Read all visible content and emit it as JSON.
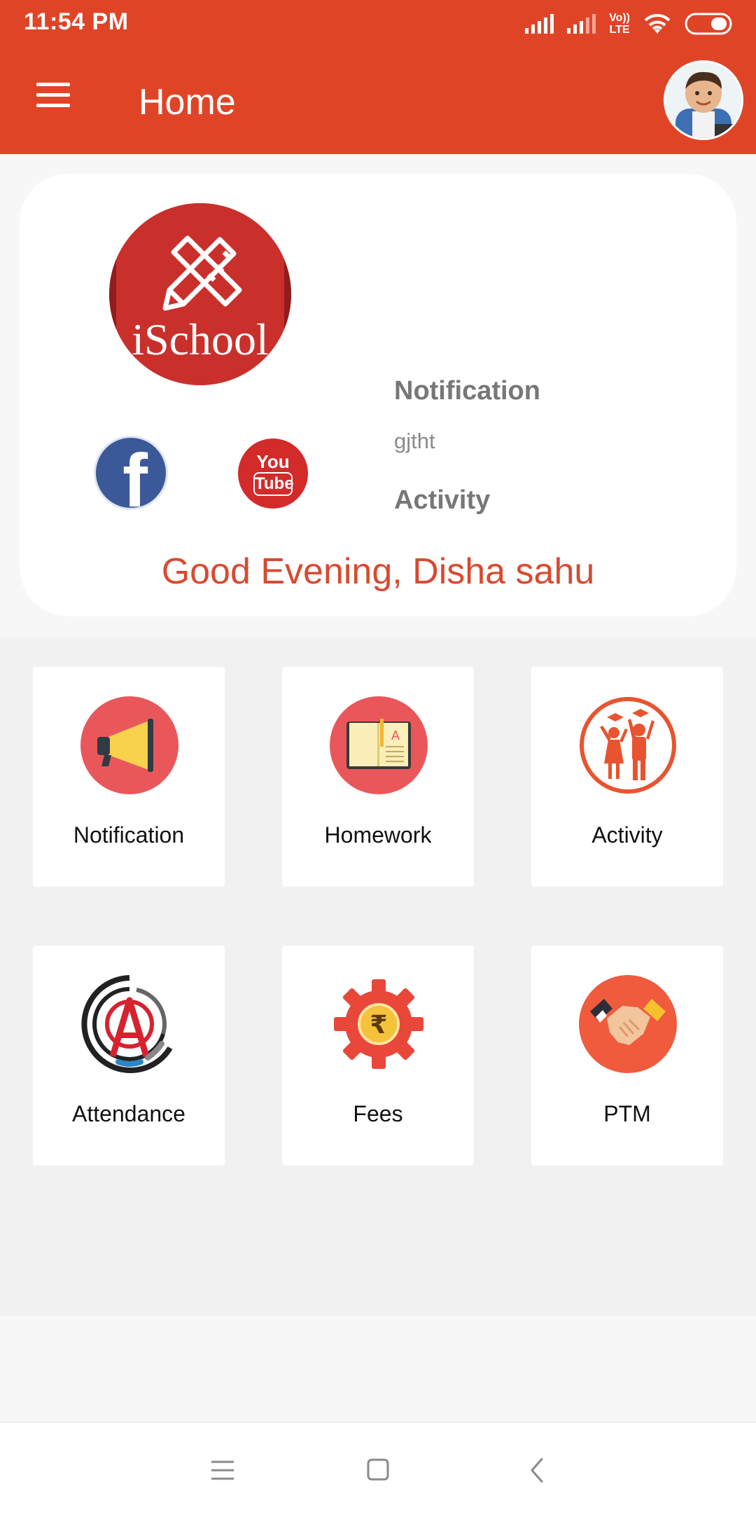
{
  "status_bar": {
    "time": "11:54 PM",
    "volte_top": "Vo))",
    "volte_bottom": "LTE"
  },
  "app_bar": {
    "title": "Home"
  },
  "header_card": {
    "school_name": "iSchool",
    "feed": [
      {
        "heading": "Notification",
        "text": "gjtht"
      },
      {
        "heading": "Activity",
        "text": ""
      }
    ],
    "youtube_top": "You",
    "youtube_bottom": "Tube",
    "greeting": "Good Evening, Disha sahu"
  },
  "tiles": [
    {
      "label": "Notification",
      "icon": "megaphone-icon"
    },
    {
      "label": "Homework",
      "icon": "book-icon"
    },
    {
      "label": "Activity",
      "icon": "students-icon"
    },
    {
      "label": "Attendance",
      "icon": "attendance-icon"
    },
    {
      "label": "Fees",
      "icon": "rupee-gear-icon"
    },
    {
      "label": "PTM",
      "icon": "handshake-icon"
    }
  ],
  "colors": {
    "primary": "#e04427",
    "greeting": "#d84a30",
    "tile_bg": "#ffffff",
    "grid_bg": "#f1f1f1"
  },
  "nav_bar": {
    "buttons": [
      "menu-icon",
      "home-square-icon",
      "back-icon"
    ]
  }
}
